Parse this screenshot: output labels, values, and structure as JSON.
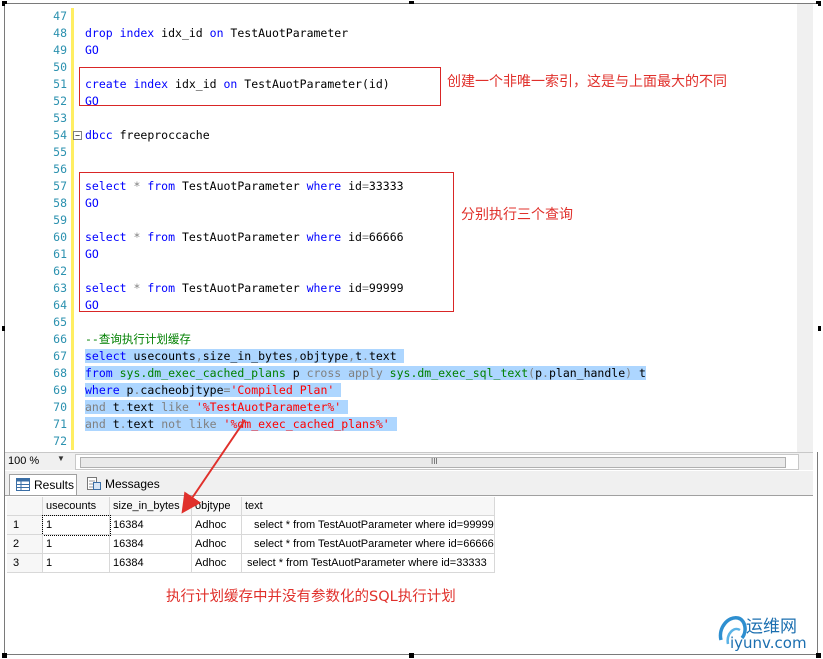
{
  "editor": {
    "lines": [
      {
        "num": "47"
      },
      {
        "num": "48",
        "tokens": [
          {
            "t": "drop index ",
            "c": "kw"
          },
          {
            "t": "idx_id "
          },
          {
            "t": "on ",
            "c": "kw"
          },
          {
            "t": "TestAuotParameter"
          }
        ]
      },
      {
        "num": "49",
        "tokens": [
          {
            "t": "GO",
            "c": "kw"
          }
        ]
      },
      {
        "num": "50"
      },
      {
        "num": "51",
        "tokens": [
          {
            "t": "create index ",
            "c": "kw"
          },
          {
            "t": "idx_id "
          },
          {
            "t": "on ",
            "c": "kw"
          },
          {
            "t": "TestAuotParameter(id)"
          }
        ]
      },
      {
        "num": "52",
        "tokens": [
          {
            "t": "GO",
            "c": "kw"
          }
        ]
      },
      {
        "num": "53"
      },
      {
        "num": "54",
        "tokens": [
          {
            "t": "dbcc ",
            "c": "kw"
          },
          {
            "t": "freeproccache"
          }
        ]
      },
      {
        "num": "55"
      },
      {
        "num": "56"
      },
      {
        "num": "57",
        "tokens": [
          {
            "t": "select ",
            "c": "kw"
          },
          {
            "t": "* ",
            "c": "gray"
          },
          {
            "t": "from ",
            "c": "kw"
          },
          {
            "t": "TestAuotParameter "
          },
          {
            "t": "where ",
            "c": "kw"
          },
          {
            "t": "id"
          },
          {
            "t": "=",
            "c": "gray"
          },
          {
            "t": "33333"
          }
        ]
      },
      {
        "num": "58",
        "tokens": [
          {
            "t": "GO",
            "c": "kw"
          }
        ]
      },
      {
        "num": "59"
      },
      {
        "num": "60",
        "tokens": [
          {
            "t": "select ",
            "c": "kw"
          },
          {
            "t": "* ",
            "c": "gray"
          },
          {
            "t": "from ",
            "c": "kw"
          },
          {
            "t": "TestAuotParameter "
          },
          {
            "t": "where ",
            "c": "kw"
          },
          {
            "t": "id"
          },
          {
            "t": "=",
            "c": "gray"
          },
          {
            "t": "66666"
          }
        ]
      },
      {
        "num": "61",
        "tokens": [
          {
            "t": "GO",
            "c": "kw"
          }
        ]
      },
      {
        "num": "62"
      },
      {
        "num": "63",
        "tokens": [
          {
            "t": "select ",
            "c": "kw"
          },
          {
            "t": "* ",
            "c": "gray"
          },
          {
            "t": "from ",
            "c": "kw"
          },
          {
            "t": "TestAuotParameter "
          },
          {
            "t": "where ",
            "c": "kw"
          },
          {
            "t": "id"
          },
          {
            "t": "=",
            "c": "gray"
          },
          {
            "t": "99999"
          }
        ]
      },
      {
        "num": "64",
        "tokens": [
          {
            "t": "GO",
            "c": "kw"
          }
        ]
      },
      {
        "num": "65"
      },
      {
        "num": "66",
        "tokens": [
          {
            "t": "--查询执行计划缓存",
            "c": "cm"
          }
        ]
      },
      {
        "num": "67",
        "tokens": [
          {
            "t": "select ",
            "c": "kw"
          },
          {
            "t": "usecounts"
          },
          {
            "t": ",",
            "c": "gray"
          },
          {
            "t": "size_in_bytes"
          },
          {
            "t": ",",
            "c": "gray"
          },
          {
            "t": "objtype"
          },
          {
            "t": ",",
            "c": "gray"
          },
          {
            "t": "t"
          },
          {
            "t": ".",
            "c": "gray"
          },
          {
            "t": "text "
          }
        ]
      },
      {
        "num": "68",
        "tokens": [
          {
            "t": "from ",
            "c": "kw"
          },
          {
            "t": "sys.dm_exec_cached_plans ",
            "c": "sys"
          },
          {
            "t": "p "
          },
          {
            "t": "cross apply ",
            "c": "gray"
          },
          {
            "t": "sys.dm_exec_sql_text",
            "c": "sys"
          },
          {
            "t": "(",
            "c": "gray"
          },
          {
            "t": "p"
          },
          {
            "t": ".",
            "c": "gray"
          },
          {
            "t": "plan_handle"
          },
          {
            "t": ")",
            "c": "gray"
          },
          {
            "t": " t"
          }
        ]
      },
      {
        "num": "69",
        "tokens": [
          {
            "t": "where ",
            "c": "kw"
          },
          {
            "t": "p"
          },
          {
            "t": ".",
            "c": "gray"
          },
          {
            "t": "cacheobjtype"
          },
          {
            "t": "=",
            "c": "gray"
          },
          {
            "t": "'Compiled Plan'",
            "c": "str"
          },
          {
            "t": " "
          }
        ]
      },
      {
        "num": "70",
        "tokens": [
          {
            "t": "and ",
            "c": "gray"
          },
          {
            "t": "t"
          },
          {
            "t": ".",
            "c": "gray"
          },
          {
            "t": "text "
          },
          {
            "t": "like ",
            "c": "gray"
          },
          {
            "t": "'%TestAuotParameter%'",
            "c": "str"
          },
          {
            "t": " "
          }
        ]
      },
      {
        "num": "71",
        "tokens": [
          {
            "t": "and ",
            "c": "gray"
          },
          {
            "t": "t"
          },
          {
            "t": ".",
            "c": "gray"
          },
          {
            "t": "text "
          },
          {
            "t": "not like ",
            "c": "gray"
          },
          {
            "t": "'%dm_exec_cached_plans%'",
            "c": "str"
          },
          {
            "t": " "
          }
        ]
      },
      {
        "num": "72"
      }
    ],
    "selected_from": "67",
    "selected_to": "71"
  },
  "annotations": {
    "create_index_note": "创建一个非唯一索引，这是与上面最大的不同",
    "three_queries_note": "分别执行三个查询",
    "result_note": "执行计划缓存中并没有参数化的SQL执行计划"
  },
  "statusbar": {
    "zoom": "100 %",
    "grip": "III"
  },
  "results": {
    "tabs": [
      {
        "label": "Results",
        "icon": "grid-icon",
        "active": true
      },
      {
        "label": "Messages",
        "icon": "messages-icon",
        "active": false
      }
    ],
    "columns": [
      "usecounts",
      "size_in_bytes",
      "objtype",
      "text"
    ],
    "rows": [
      {
        "n": "1",
        "usecounts": "1",
        "size_in_bytes": "16384",
        "objtype": "Adhoc",
        "text": "select * from TestAuotParameter where id=99999"
      },
      {
        "n": "2",
        "usecounts": "1",
        "size_in_bytes": "16384",
        "objtype": "Adhoc",
        "text": "select * from TestAuotParameter where id=66666"
      },
      {
        "n": "3",
        "usecounts": "1",
        "size_in_bytes": "16384",
        "objtype": "Adhoc",
        "text": "select * from TestAuotParameter where id=33333"
      }
    ]
  },
  "watermark": {
    "brand": "运维网",
    "domain": "iyunv.com"
  },
  "colors": {
    "keyword": "#0000ff",
    "system_object": "#008000",
    "string": "#ff0000",
    "annotation": "#e0302b",
    "selection": "#add6ff"
  }
}
